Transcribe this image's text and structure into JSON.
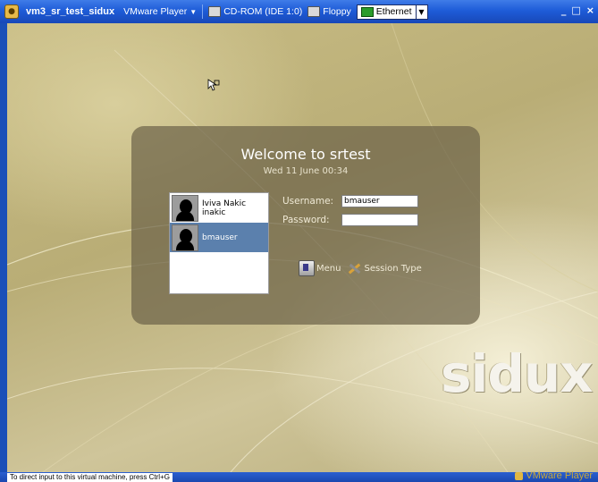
{
  "titlebar": {
    "vm_name": "vm3_sr_test_sidux",
    "player_menu": "VMware Player",
    "cdrom_label": "CD-ROM (IDE 1:0)",
    "floppy_label": "Floppy",
    "ethernet_label": "Ethernet",
    "minimize": "_",
    "maximize": "□",
    "close": "×"
  },
  "login": {
    "welcome": "Welcome to srtest",
    "datetime": "Wed 11 June 00:34",
    "users": [
      {
        "name": "Iviva Nakic",
        "login": "inakic",
        "selected": false
      },
      {
        "name": "bmauser",
        "login": "",
        "selected": true
      }
    ],
    "username_label": "Username:",
    "username_value": "bmauser",
    "password_label": "Password:",
    "password_value": "",
    "menu_label": "Menu",
    "session_label": "Session Type"
  },
  "logo_text": "sidux",
  "statusbar": {
    "hint": "To direct input to this virtual machine, press Ctrl+G",
    "brand": "VMware Player"
  },
  "colors": {
    "titlebar": "#1e5cd8",
    "panel": "#6e644a",
    "selected_user": "#5b80ad",
    "brand": "#c9a83a"
  }
}
